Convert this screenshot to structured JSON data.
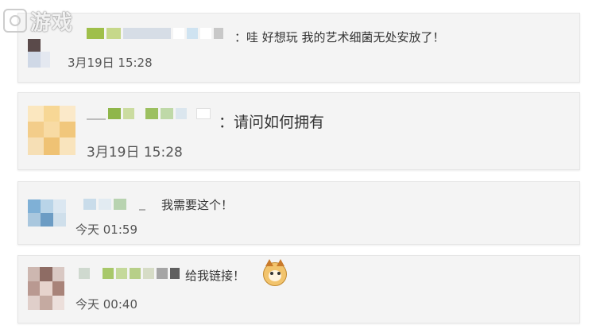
{
  "watermark": {
    "text": "游戏"
  },
  "comments": [
    {
      "text": "：哇 好想玩  我的艺术细菌无处安放了！",
      "time": "3月19日 15:28"
    },
    {
      "text": "：请问如何拥有",
      "time": "3月19日 15:28"
    },
    {
      "text": "我需要这个！",
      "time": "今天 01:59"
    },
    {
      "text": "给我链接！",
      "time": "今天 00:40",
      "emoji": "cat-face-icon"
    }
  ],
  "colors": {
    "card_bg": "#f4f4f4",
    "text": "#333333",
    "time": "#555555"
  }
}
